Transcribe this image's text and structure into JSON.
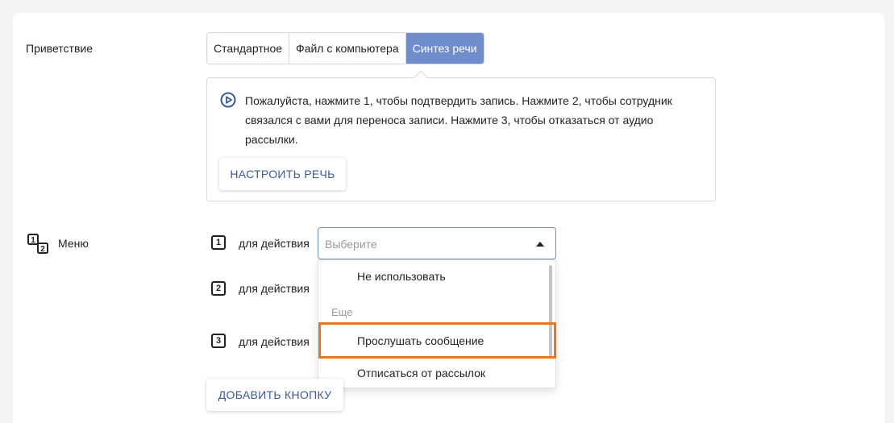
{
  "greeting": {
    "label": "Приветствие",
    "tabs": [
      {
        "label": "Стандартное",
        "active": false
      },
      {
        "label": "Файл с компьютера",
        "active": false
      },
      {
        "label": "Синтез речи",
        "active": true
      }
    ],
    "speech_text": "Пожалуйста, нажмите 1, чтобы подтвердить запись. Нажмите 2, чтобы сотрудник связался с вами для переноса записи. Нажмите 3, чтобы отказаться от аудио рассылки.",
    "configure_button": "НАСТРОИТЬ РЕЧЬ",
    "play_icon": "play-circle-icon"
  },
  "menu": {
    "label": "Меню",
    "icon": "numbered-list-icon",
    "items": [
      {
        "number": "1",
        "label": "для действия"
      },
      {
        "number": "2",
        "label": "для действия"
      },
      {
        "number": "3",
        "label": "для действия"
      }
    ],
    "select": {
      "placeholder": "Выберите",
      "options": {
        "none": "Не использовать",
        "group": "Еще",
        "listen": "Прослушать сообщение",
        "unsubscribe": "Отписаться от рассылок"
      }
    },
    "add_button": "ДОБАВИТЬ КНОПКУ"
  },
  "colors": {
    "accent": "#6f8ccb",
    "button_text": "#3a5a9c",
    "highlight": "#f07318"
  }
}
